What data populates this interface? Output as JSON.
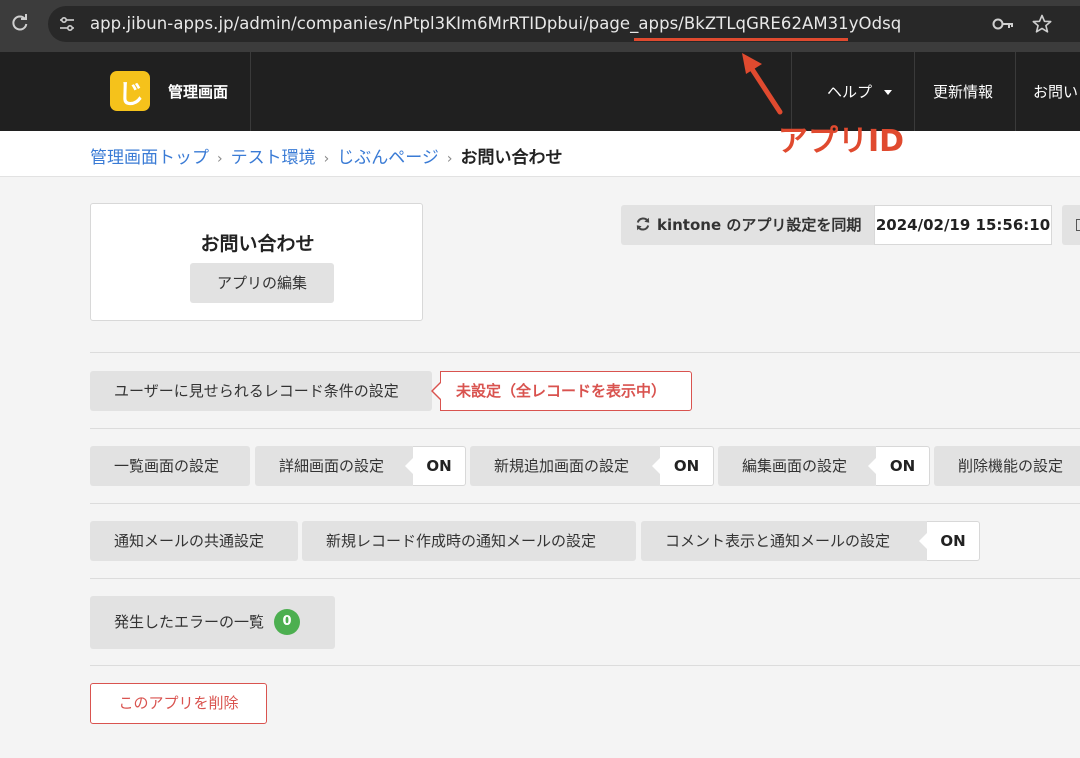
{
  "browser": {
    "url_prefix": "app.jibun-apps.jp/admin/companies/nPtpl3KIm6MrRTIDpbui/page_apps/",
    "url_app_id": "BkZTLqGRE62AM31yOdsq"
  },
  "header": {
    "logo_glyph": "じ",
    "app_name": "管理画面",
    "nav": {
      "help": "ヘルプ",
      "updates": "更新情報",
      "contact": "お問い"
    }
  },
  "breadcrumb": {
    "items": [
      "管理画面トップ",
      "テスト環境",
      "じぶんページ"
    ],
    "separator": "›",
    "current": "お問い合わせ"
  },
  "annotation": {
    "label": "アプリID",
    "color": "#e04a2f"
  },
  "app_card": {
    "title": "お問い合わせ",
    "edit_button": "アプリの編集"
  },
  "sync": {
    "button_label": "kintone のアプリ設定を同期",
    "timestamp": "2024/02/19 15:56:10"
  },
  "record_condition": {
    "button_label": "ユーザーに見せられるレコード条件の設定",
    "status": "未設定（全レコードを表示中）"
  },
  "screen_settings": {
    "list": "一覧画面の設定",
    "detail": "詳細画面の設定",
    "detail_status": "ON",
    "new": "新規追加画面の設定",
    "new_status": "ON",
    "edit": "編集画面の設定",
    "edit_status": "ON",
    "delete": "削除機能の設定"
  },
  "mail_settings": {
    "common": "通知メールの共通設定",
    "new_record": "新規レコード作成時の通知メールの設定",
    "comment": "コメント表示と通知メールの設定",
    "comment_status": "ON"
  },
  "errors": {
    "label": "発生したエラーの一覧",
    "count": "0"
  },
  "danger": {
    "delete_label": "このアプリを削除"
  },
  "colors": {
    "accent_link": "#3a7bd5",
    "danger": "#d9534f",
    "success": "#4caf50",
    "logo": "#f5c21b",
    "header_bg": "#202020"
  }
}
